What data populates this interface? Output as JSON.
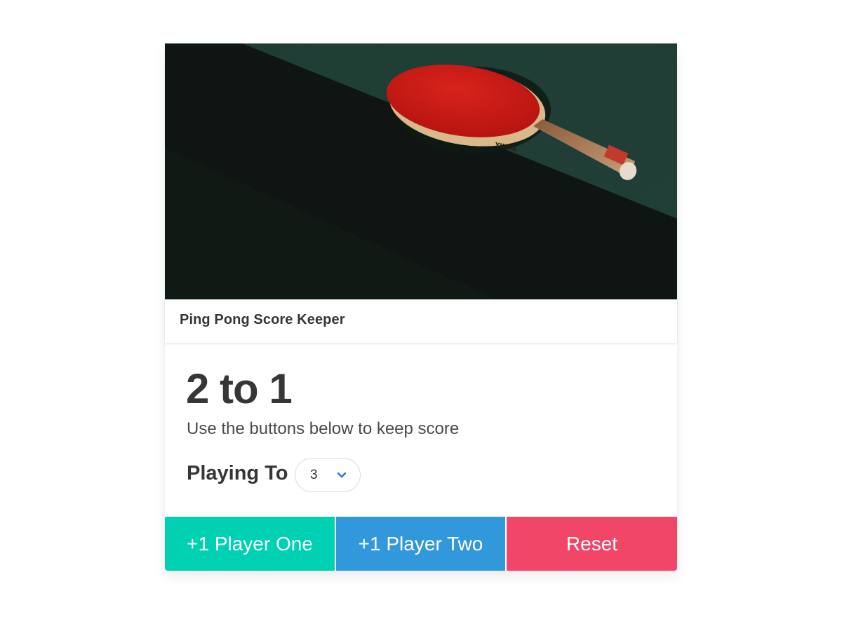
{
  "card": {
    "header_title": "Ping Pong Score Keeper",
    "image_description_icon": "ping-pong-paddle-photo"
  },
  "score": {
    "text": "2 to 1",
    "player_one": 2,
    "player_two": 1,
    "subtitle": "Use the buttons below to keep score"
  },
  "playing_to": {
    "label": "Playing To",
    "selected_value": "3"
  },
  "buttons": {
    "player_one_label": "+1 Player One",
    "player_two_label": "+1 Player Two",
    "reset_label": "Reset"
  },
  "colors": {
    "player_one": "#00d1b2",
    "player_two": "#3298dc",
    "reset": "#f14668",
    "chevron": "#3273dc"
  }
}
